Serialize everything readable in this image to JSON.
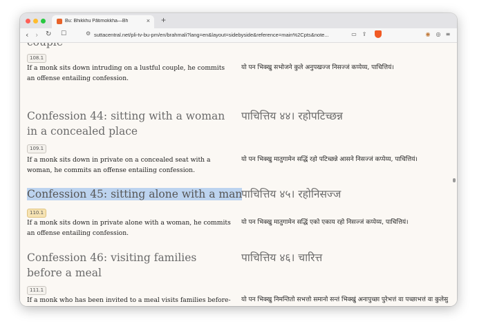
{
  "browser": {
    "tab": {
      "title": "Bu: Bhikkhu Pātimokkha—Bh"
    },
    "new_tab": "+",
    "url": "suttacentral.net/pli-tv-bu-pm/en/brahmali?lang=en&layout=sidebyside&reference=main%2Cpts&note...",
    "colors": {
      "close": "#ff5f57",
      "minimize": "#febc2e",
      "zoom": "#28c840",
      "brave": "#f15a24"
    }
  },
  "page": {
    "partial_heading": "couple",
    "sections": [
      {
        "ref": "108.1",
        "en": "If a monk sits down intruding on a lustful couple, he commits an offense entailing confession.",
        "pi": "यो पन भिक्खु सभोजने कुले अनुपखज्ज निसज्जं कप्पेय्य, पाचित्तियं।"
      },
      {
        "heading_en": "Confession 44: sitting with a woman in a concealed place",
        "heading_pi": "पाचित्तिय ४४। रहोपटिच्छन्न",
        "ref": "109.1",
        "en": "If a monk sits down in private on a concealed seat with a woman, he commits an offense entailing confession.",
        "pi": "यो पन भिक्खु मातुगामेन सद्धिं रहो पटिच्छन्ने आसने निसज्जं कप्पेय्य, पाचित्तियं।"
      },
      {
        "heading_en": "Confession 45: sitting alone with a man",
        "heading_pi": "पाचित्तिय ४५। रहोनिसज्ज",
        "ref": "110.1",
        "en": "If a monk sits down in private alone with a woman, he commits an offense entailing confession.",
        "pi": "यो पन भिक्खु मातुगामेन सद्धिं एको एकाय रहो निसज्जं कप्पेय्य, पाचित्तियं।"
      },
      {
        "heading_en": "Confession 46: visiting families before a meal",
        "heading_pi": "पाचित्तिय ४६। चारित्त",
        "ref": "111.1",
        "en": "If a monk who has been invited to a meal visits families before-hand or afterwards without informing an available monk, except",
        "pi": "यो पन भिक्खु निमन्तितो सभत्तो समानो सन्तं भिक्खुं अनापुच्छा पुरेभत्तं वा पच्छाभत्तं वा कुलेसु चारित्तं आपज्जेय्य अञ्ञत्र समया, पाचित्तियं।"
      }
    ]
  }
}
